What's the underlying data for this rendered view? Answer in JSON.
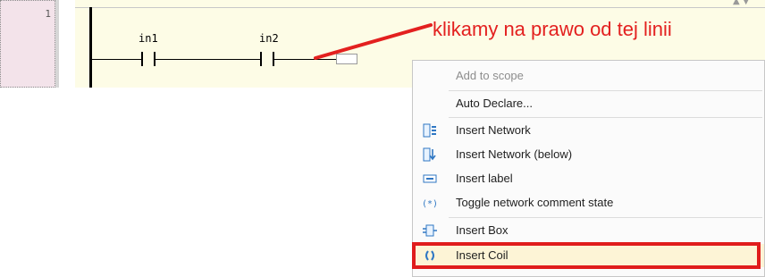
{
  "editor": {
    "network_number": "1",
    "contacts": [
      {
        "variable": "in1"
      },
      {
        "variable": "in2"
      }
    ]
  },
  "annotation": {
    "text": "klikamy na prawo od tej linii",
    "color": "#e3201f"
  },
  "context_menu": {
    "items": [
      {
        "label": "Add to scope",
        "icon": "",
        "disabled": true
      },
      {
        "label": "Auto Declare...",
        "icon": ""
      },
      {
        "label": "Insert Network",
        "icon": "insert-network-icon"
      },
      {
        "label": "Insert Network (below)",
        "icon": "insert-network-below-icon"
      },
      {
        "label": "Insert label",
        "icon": "insert-label-icon"
      },
      {
        "label": "Toggle network comment state",
        "icon": "toggle-comment-icon"
      },
      {
        "label": "Insert Box",
        "icon": "insert-box-icon"
      },
      {
        "label": "Insert Coil",
        "icon": "insert-coil-icon",
        "highlighted": true
      }
    ]
  },
  "colors": {
    "highlight_frame": "#e01c1c",
    "network_background": "#fdfce6"
  }
}
